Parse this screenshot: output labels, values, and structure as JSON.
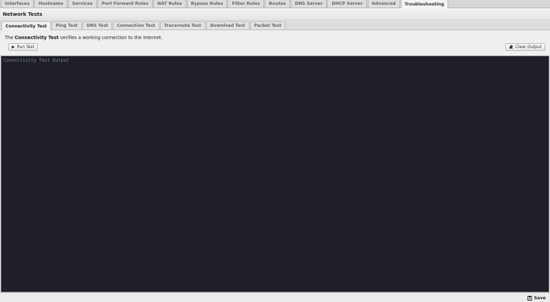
{
  "top_tabs": [
    {
      "label": "Interfaces"
    },
    {
      "label": "Hostname"
    },
    {
      "label": "Services"
    },
    {
      "label": "Port Forward Rules"
    },
    {
      "label": "NAT Rules"
    },
    {
      "label": "Bypass Rules"
    },
    {
      "label": "Filter Rules"
    },
    {
      "label": "Routes"
    },
    {
      "label": "DNS Server"
    },
    {
      "label": "DHCP Server"
    },
    {
      "label": "Advanced"
    },
    {
      "label": "Troubleshooting",
      "active": true
    }
  ],
  "section": {
    "title": "Network Tests"
  },
  "sub_tabs": [
    {
      "label": "Connectivity Test",
      "active": true
    },
    {
      "label": "Ping Test"
    },
    {
      "label": "DNS Test"
    },
    {
      "label": "Connection Test"
    },
    {
      "label": "Traceroute Test"
    },
    {
      "label": "Download Test"
    },
    {
      "label": "Packet Test"
    }
  ],
  "panel": {
    "desc_prefix": "The ",
    "desc_bold": "Connectivity Test",
    "desc_suffix": " verifies a working connection to the Internet.",
    "run_label": "Run Test",
    "clear_label": "Clear Output",
    "run_icon": "play-icon",
    "clear_icon": "eraser-icon"
  },
  "console": {
    "placeholder": "Connectivity Test Output"
  },
  "footer": {
    "save_label": "Save",
    "save_icon": "floppy-disk-icon"
  }
}
